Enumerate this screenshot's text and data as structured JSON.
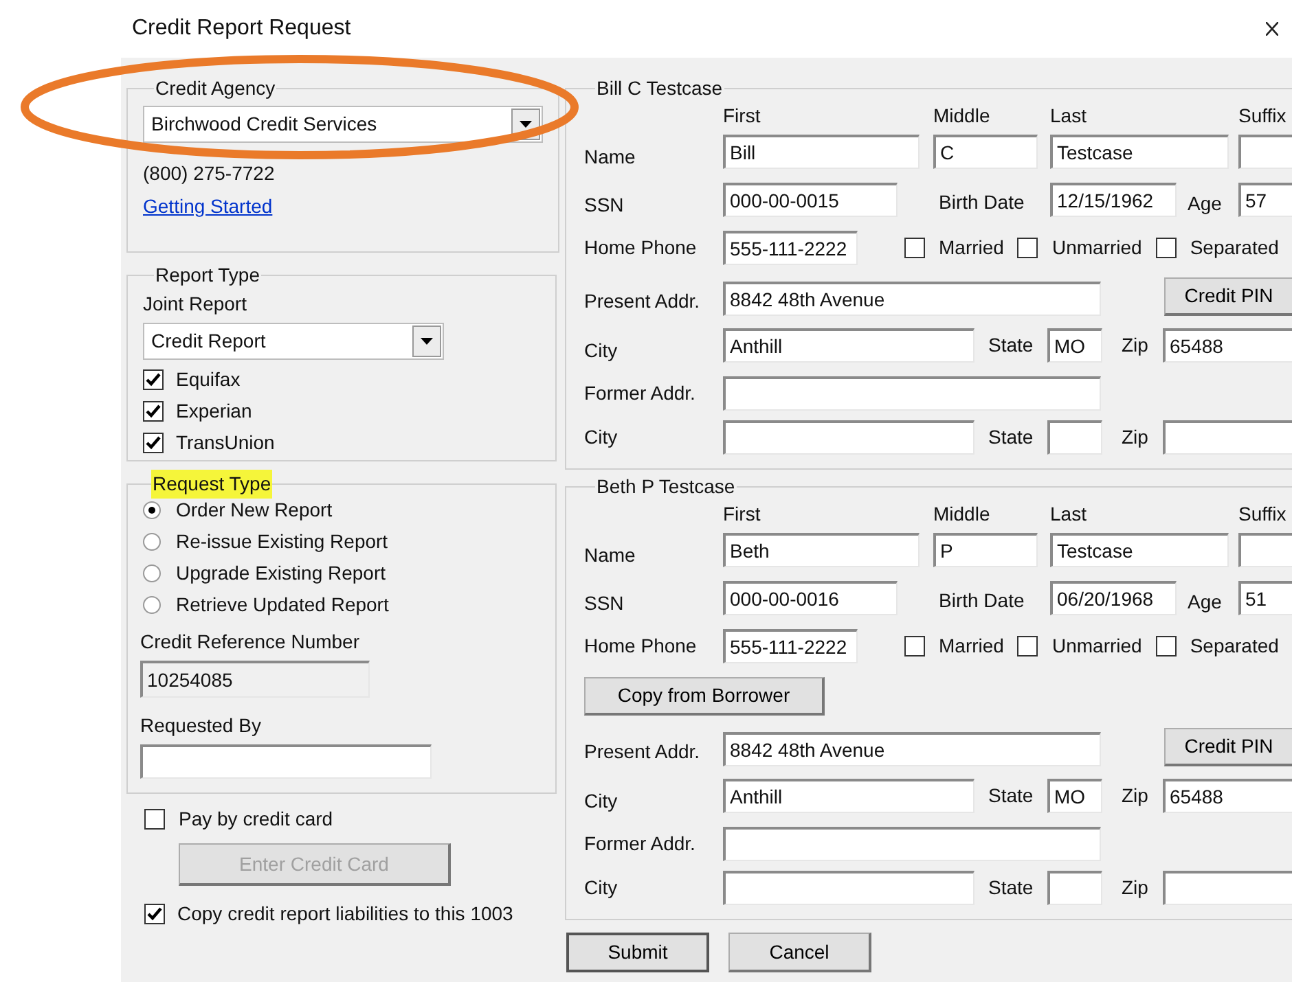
{
  "window": {
    "title": "Credit Report Request"
  },
  "annotation": {
    "kind": "ellipse"
  },
  "credit_agency": {
    "legend": "Credit Agency",
    "agency": "Birchwood Credit Services",
    "phone": "(800) 275-7722",
    "link": "Getting Started"
  },
  "report_type": {
    "legend": "Report Type",
    "joint_label": "Joint Report",
    "report": "Credit Report",
    "bureaus": [
      {
        "label": "Equifax",
        "checked": true
      },
      {
        "label": "Experian",
        "checked": true
      },
      {
        "label": "TransUnion",
        "checked": true
      }
    ]
  },
  "request_type": {
    "legend": "Request Type",
    "highlighted": true,
    "options": [
      {
        "label": "Order New Report",
        "selected": true
      },
      {
        "label": "Re-issue Existing Report",
        "selected": false
      },
      {
        "label": "Upgrade Existing Report",
        "selected": false
      },
      {
        "label": "Retrieve Updated Report",
        "selected": false
      }
    ],
    "reference_label": "Credit Reference Number",
    "reference": "10254085",
    "requested_by_label": "Requested By"
  },
  "pay_by_card": {
    "label": "Pay by credit card",
    "checked": false
  },
  "enter_card_button": {
    "label": "Enter Credit Card",
    "disabled": true
  },
  "copy_liabilities": {
    "label": "Copy credit report liabilities to this 1003",
    "checked": true
  },
  "borrowers": [
    {
      "legend": "Bill C Testcase",
      "headers": [
        "First",
        "Middle",
        "Last",
        "Suffix"
      ],
      "name_label": "Name",
      "first": "Bill",
      "middle": "C",
      "last": "Testcase",
      "ssn_label": "SSN",
      "ssn": "000-00-0015",
      "birth_label": "Birth Date",
      "birth": "12/15/1962",
      "age_label": "Age",
      "age": "57",
      "phone_label": "Home Phone",
      "phone": "555-111-2222",
      "marital": [
        {
          "label": "Married",
          "checked": false
        },
        {
          "label": "Unmarried",
          "checked": false
        },
        {
          "label": "Separated",
          "checked": false
        }
      ],
      "present_label": "Present Addr.",
      "present": "8842 48th Avenue",
      "pin_button": "Credit PIN",
      "city_label": "City",
      "city": "Anthill",
      "state_label": "State",
      "state": "MO",
      "zip_label": "Zip",
      "zip": "65488",
      "former_label": "Former Addr.",
      "former_city_label": "City",
      "former_state_label": "State",
      "former_zip_label": "Zip"
    },
    {
      "legend": "Beth P Testcase",
      "headers": [
        "First",
        "Middle",
        "Last",
        "Suffix"
      ],
      "name_label": "Name",
      "first": "Beth",
      "middle": "P",
      "last": "Testcase",
      "ssn_label": "SSN",
      "ssn": "000-00-0016",
      "birth_label": "Birth Date",
      "birth": "06/20/1968",
      "age_label": "Age",
      "age": "51",
      "phone_label": "Home Phone",
      "phone": "555-111-2222",
      "marital": [
        {
          "label": "Married",
          "checked": false
        },
        {
          "label": "Unmarried",
          "checked": false
        },
        {
          "label": "Separated",
          "checked": false
        }
      ],
      "copy_button": "Copy from Borrower",
      "present_label": "Present Addr.",
      "present": "8842 48th Avenue",
      "pin_button": "Credit PIN",
      "city_label": "City",
      "city": "Anthill",
      "state_label": "State",
      "state": "MO",
      "zip_label": "Zip",
      "zip": "65488",
      "former_label": "Former Addr.",
      "former_city_label": "City",
      "former_state_label": "State",
      "former_zip_label": "Zip"
    }
  ],
  "buttons": [
    {
      "label": "Submit",
      "default": true
    },
    {
      "label": "Cancel",
      "default": false
    }
  ]
}
